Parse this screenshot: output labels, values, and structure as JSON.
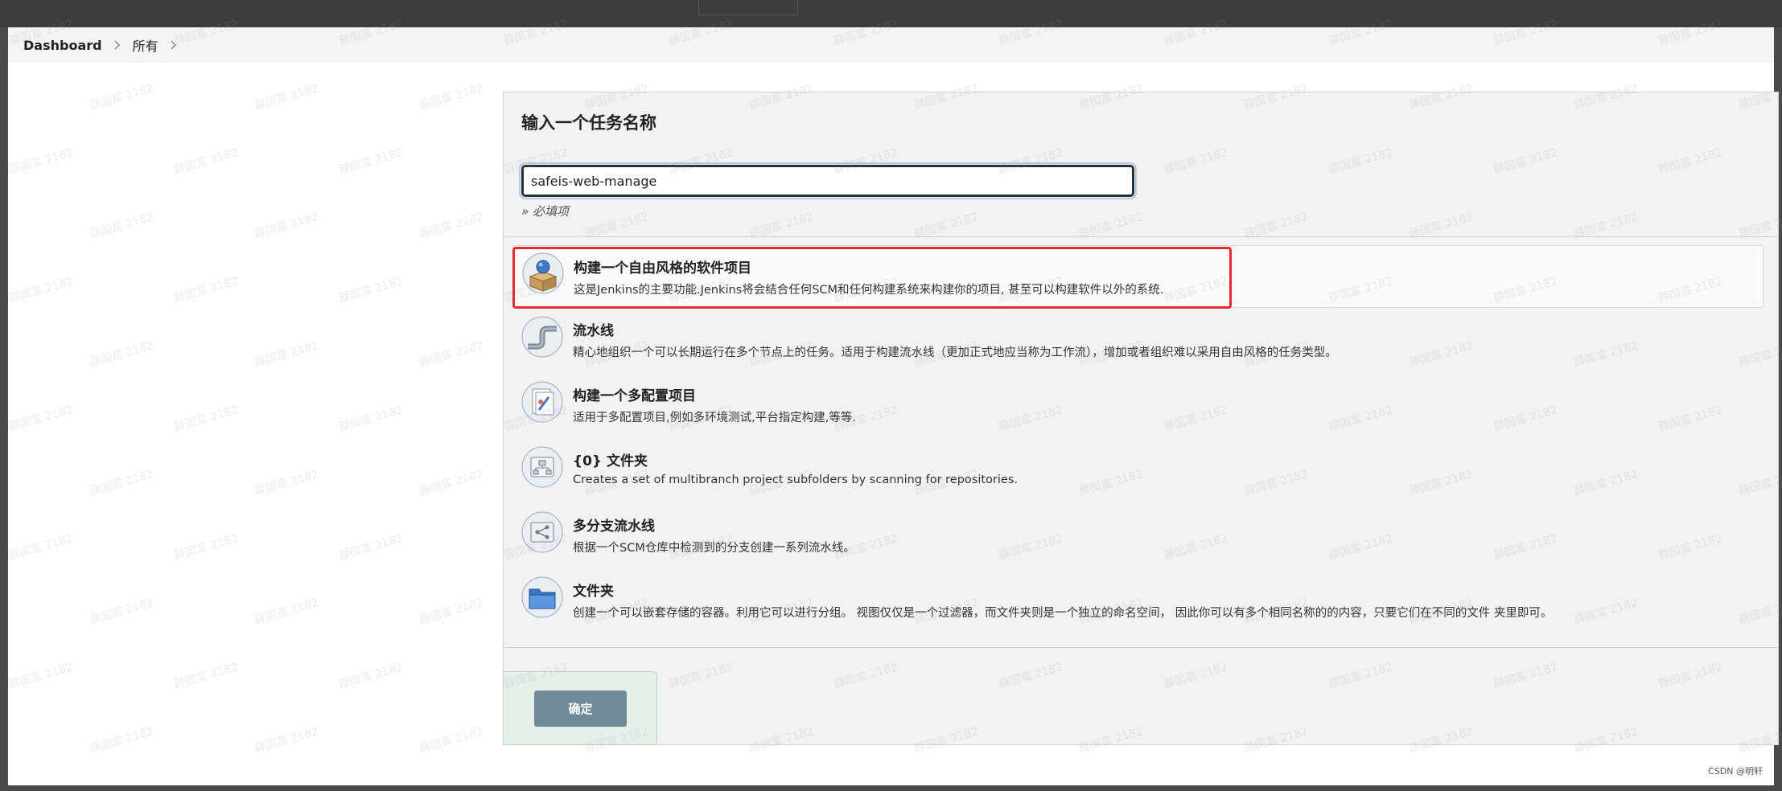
{
  "breadcrumb": {
    "items": [
      {
        "label": "Dashboard"
      },
      {
        "label": "所有"
      }
    ]
  },
  "form": {
    "title": "输入一个任务名称",
    "name_value": "safeis-web-manage",
    "required_hint": "» 必填项"
  },
  "item_types": [
    {
      "title": "构建一个自由风格的软件项目",
      "description": "这是Jenkins的主要功能.Jenkins将会结合任何SCM和任何构建系统来构建你的项目, 甚至可以构建软件以外的系统.",
      "icon": "freestyle-project-icon",
      "selected": true
    },
    {
      "title": "流水线",
      "description": "精心地组织一个可以长期运行在多个节点上的任务。适用于构建流水线（更加正式地应当称为工作流），增加或者组织难以采用自由风格的任务类型。",
      "icon": "pipeline-icon",
      "selected": false
    },
    {
      "title": "构建一个多配置项目",
      "description": "适用于多配置项目,例如多环境测试,平台指定构建,等等.",
      "icon": "multi-config-project-icon",
      "selected": false
    },
    {
      "title": "{0} 文件夹",
      "description": "Creates a set of multibranch project subfolders by scanning for repositories.",
      "icon": "organization-folder-icon",
      "selected": false
    },
    {
      "title": "多分支流水线",
      "description": "根据一个SCM仓库中检测到的分支创建一系列流水线。",
      "icon": "multibranch-pipeline-icon",
      "selected": false
    },
    {
      "title": "文件夹",
      "description": "创建一个可以嵌套存储的容器。利用它可以进行分组。 视图仅仅是一个过滤器，而文件夹则是一个独立的命名空间， 因此你可以有多个相同名称的的内容，只要它们在不同的文件 夹里即可。",
      "icon": "folder-icon",
      "selected": false
    }
  ],
  "actions": {
    "ok_label": "确定"
  },
  "watermark": {
    "text": "薛国富 2182"
  },
  "footer": {
    "credit": "CSDN @明轩"
  },
  "colors": {
    "highlight": "#e22b2b",
    "ok_button": "#6f8a99",
    "input_border": "#26313d"
  }
}
